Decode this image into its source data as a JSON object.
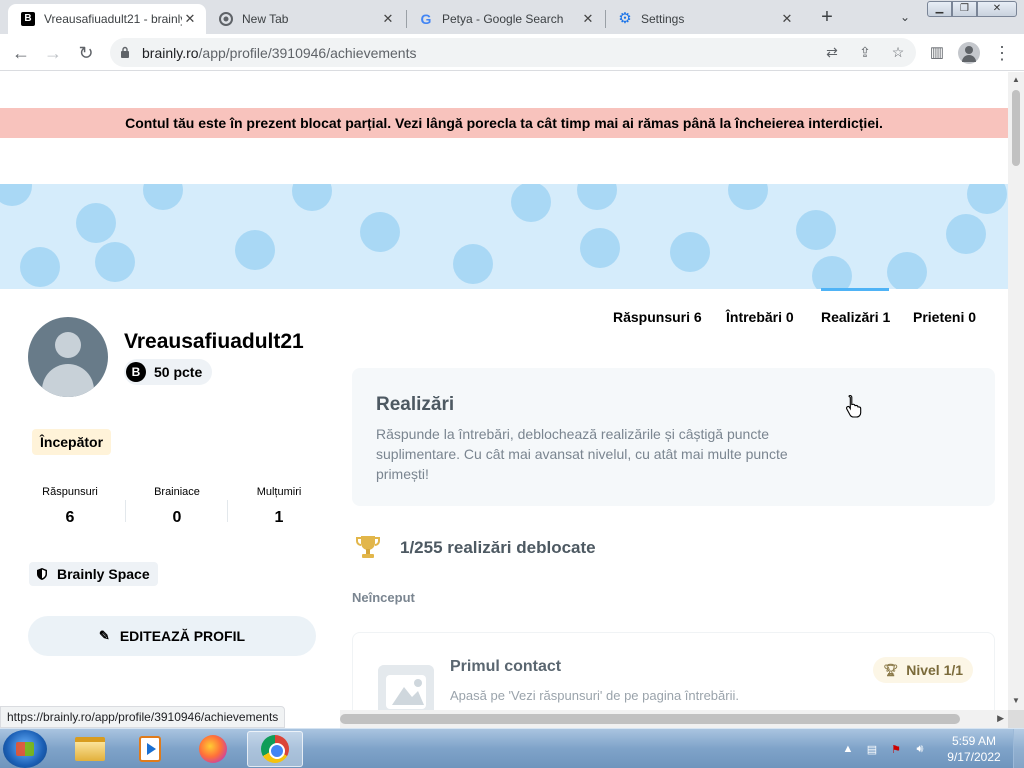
{
  "browser": {
    "tabs": [
      {
        "title": "Vreausafiuadult21 - brainly",
        "favicon": "brainly-icon",
        "active": true
      },
      {
        "title": "New Tab",
        "favicon": "chrome-icon",
        "active": false
      },
      {
        "title": "Petya - Google Search",
        "favicon": "google-icon",
        "active": false
      },
      {
        "title": "Settings",
        "favicon": "gear-icon",
        "active": false
      }
    ],
    "url_host": "brainly.ro",
    "url_path": "/app/profile/3910946/achievements",
    "status_url": "https://brainly.ro/app/profile/3910946/achievements"
  },
  "page": {
    "ban_message": "Contul tău este în prezent blocat parțial. Vezi lângă porecla ta cât timp mai ai rămas până la încheierea interdicției.",
    "profile": {
      "username": "Vreausafiuadult21",
      "points": "50 pcte",
      "rank": "Începător",
      "stats": [
        {
          "label": "Răspunsuri",
          "value": "6"
        },
        {
          "label": "Brainiace",
          "value": "0"
        },
        {
          "label": "Mulțumiri",
          "value": "1"
        }
      ],
      "space_label": "Brainly Space",
      "edit_label": "EDITEAZĂ PROFIL"
    },
    "nav_tabs": [
      {
        "label": "Răspunsuri 6",
        "active": false
      },
      {
        "label": "Întrebări 0",
        "active": false
      },
      {
        "label": "Realizări 1",
        "active": true
      },
      {
        "label": "Prieteni 0",
        "active": false
      }
    ],
    "achievements": {
      "title": "Realizări",
      "description": "Răspunde la întrebări, deblochează realizările și câștigă puncte suplimentare. Cu cât mai avansat nivelul, cu atât mai multe puncte primești!",
      "unlocked": "1/255 realizări deblocate",
      "section": "Neînceput",
      "items": [
        {
          "name": "Primul contact",
          "hint": "Apasă pe 'Vezi răspunsuri' de pe pagina întrebării.",
          "level": "Nivel 1/1"
        }
      ]
    }
  },
  "taskbar": {
    "time": "5:59 AM",
    "date": "9/17/2022",
    "apps": [
      "folder-icon",
      "media-player-icon",
      "firefox-icon",
      "chrome-icon"
    ]
  },
  "colors": {
    "ban_bg": "#f8c3bd",
    "cover_bg": "#d5ecfb",
    "cover_dots": "#a9d8f5",
    "active_tab_underline": "#4fb3f6"
  }
}
